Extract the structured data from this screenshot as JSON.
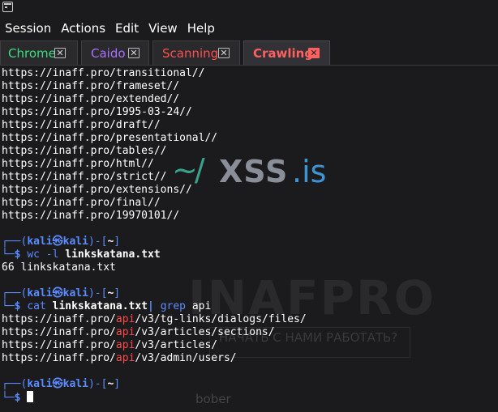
{
  "menu": [
    "Session",
    "Actions",
    "Edit",
    "View",
    "Help"
  ],
  "tabs": [
    {
      "label": "Chrome",
      "color": "#3ddc84",
      "close": "✕",
      "active": false
    },
    {
      "label": "Caido",
      "color": "#a970ff",
      "close": "✕",
      "active": false
    },
    {
      "label": "Scanning",
      "color": "#ff5050",
      "close": "✕",
      "active": false
    },
    {
      "label": "Crawling",
      "color": "#ff6060",
      "close": "✕",
      "active": true
    }
  ],
  "terminal": {
    "output_urls": [
      "https://inaff.pro/transitional//",
      "https://inaff.pro/frameset//",
      "https://inaff.pro/extended//",
      "https://inaff.pro/1995-03-24//",
      "https://inaff.pro/draft//",
      "https://inaff.pro/presentational//",
      "https://inaff.pro/tables//",
      "https://inaff.pro/html//",
      "https://inaff.pro/strict//",
      "https://inaff.pro/extensions//",
      "https://inaff.pro/final//",
      "https://inaff.pro/19970101//"
    ],
    "prompt": {
      "top_left": "┌──(",
      "user": "kali",
      "at": "㉿",
      "host": "kali",
      "mid": ")-[",
      "dir": "~",
      "end": "]",
      "bottom": "└─",
      "dollar": "$"
    },
    "cmd1": {
      "prog": "wc",
      "flag": "-l",
      "file": "linkskatana.txt"
    },
    "cmd1_output": "66 linkskatana.txt",
    "cmd2": {
      "prog": "cat",
      "file": "linkskatana.txt",
      "pipe": "|",
      "prog2": "grep",
      "arg": "api"
    },
    "grep_results": [
      {
        "pre": "https://inaff.pro/",
        "match": "api",
        "post": "/v3/tg-links/dialogs/files/"
      },
      {
        "pre": "https://inaff.pro/",
        "match": "api",
        "post": "/v3/articles/sections/"
      },
      {
        "pre": "https://inaff.pro/",
        "match": "api",
        "post": "/v3/articles/"
      },
      {
        "pre": "https://inaff.pro/",
        "match": "api",
        "post": "/v3/admin/users/"
      }
    ]
  },
  "watermark": {
    "tilde": "~/",
    "xss": "XSS",
    "is": ".is",
    "brand": "INAFPRO",
    "slogan": "НАЧАТЬ С НАМИ РАБОТАТЬ?",
    "user": "bober"
  }
}
